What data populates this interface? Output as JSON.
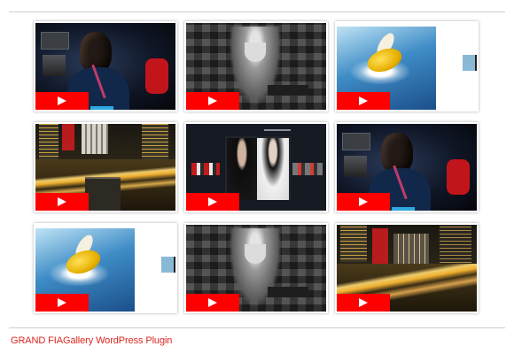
{
  "gallery": {
    "tiles": [
      {
        "scene": "boy-portrait",
        "play_icon": "play-icon"
      },
      {
        "scene": "old-man-mosaic",
        "play_icon": "play-icon"
      },
      {
        "scene": "bird-splash",
        "play_icon": "play-icon"
      },
      {
        "scene": "city-night-traffic",
        "play_icon": "play-icon"
      },
      {
        "scene": "fashion-models",
        "play_icon": "play-icon"
      },
      {
        "scene": "boy-portrait",
        "play_icon": "play-icon"
      },
      {
        "scene": "bird-splash",
        "play_icon": "play-icon"
      },
      {
        "scene": "old-man-mosaic",
        "play_icon": "play-icon"
      },
      {
        "scene": "city-night-traffic",
        "play_icon": "play-icon"
      }
    ]
  },
  "caption": "GRAND FIAGallery WordPress Plugin",
  "colors": {
    "play_button": "#ff0000",
    "caption_text": "#d9271f",
    "rule": "#cfcfcf"
  }
}
